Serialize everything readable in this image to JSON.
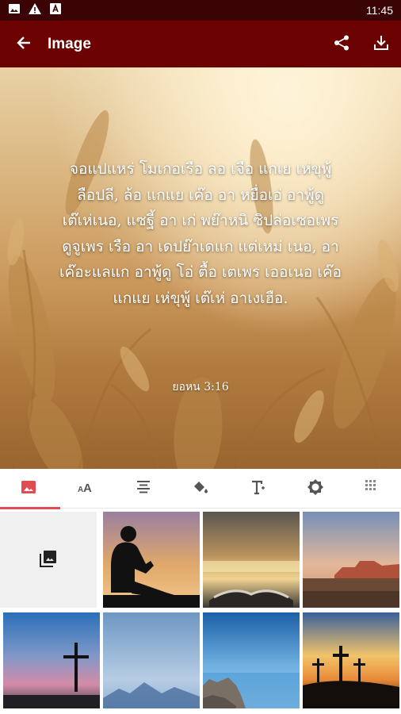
{
  "status_bar": {
    "time": "11:45",
    "icons": [
      "photo-icon",
      "warning-icon",
      "text-icon"
    ]
  },
  "app_bar": {
    "title": "Image",
    "back_icon": "arrow-back-icon",
    "actions": [
      "share-icon",
      "download-icon"
    ]
  },
  "preview": {
    "verse_lines": [
      "จอแปแหร่ โมเกอเรือ ลอ เจือ แกเย เห่ขุพู้",
      "ลือปลี, ล้อ แกแย เค๊อ อา หยื่อเอ่ อาพู้ดู",
      "เต๊เห่เนอ, แซฐี้ อา เก่ พย๊าหนิ ซิปล่อเซอเพร",
      "ดูจูเพร เรือ อา เดปย๊าเดแก แต่เหม่ เนอ, อา",
      "เค๊อะแลแก อาพู้ดู โอ่ ตื้อ เตเพร เออเนอ เค๊อ",
      "แกแย เห่ขุพู้ เต๊เห่ อาเงเฮือ."
    ],
    "reference": "ยอหน 3:16"
  },
  "tabs": [
    {
      "name": "image-tab",
      "icon": "image-icon",
      "active": true
    },
    {
      "name": "font-size-tab",
      "icon": "font-size-icon",
      "active": false
    },
    {
      "name": "align-tab",
      "icon": "align-center-icon",
      "active": false
    },
    {
      "name": "color-tab",
      "icon": "paint-bucket-icon",
      "active": false
    },
    {
      "name": "text-style-tab",
      "icon": "text-format-icon",
      "active": false
    },
    {
      "name": "brightness-tab",
      "icon": "brightness-icon",
      "active": false
    },
    {
      "name": "texture-tab",
      "icon": "texture-icon",
      "active": false
    }
  ],
  "gallery": {
    "first_cell_icon": "photo-library-icon",
    "thumbnails": [
      "child-reading-silhouette",
      "open-bible-sunset",
      "desert-mesa-sunset",
      "cross-silhouette-dusk",
      "mountain-haze",
      "lake-rocks",
      "three-crosses-sunset"
    ]
  },
  "colors": {
    "status_bar": "#3a0404",
    "app_bar": "#6b0101",
    "accent": "#e24b51"
  }
}
